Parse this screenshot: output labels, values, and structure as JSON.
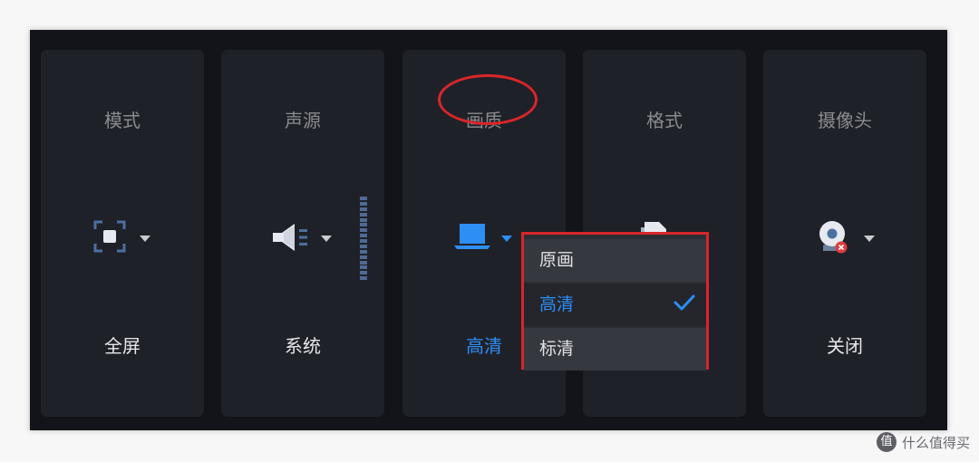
{
  "cards": [
    {
      "title": "模式",
      "value": "全屏",
      "icon": "fullscreen-icon"
    },
    {
      "title": "声源",
      "value": "系统",
      "icon": "speaker-icon"
    },
    {
      "title": "画质",
      "value": "高清",
      "icon": "laptop-icon"
    },
    {
      "title": "格式",
      "value": "",
      "icon": "file-icon"
    },
    {
      "title": "摄像头",
      "value": "关闭",
      "icon": "camera-off-icon"
    }
  ],
  "quality_dropdown": {
    "options": [
      "原画",
      "高清",
      "标清"
    ],
    "selected": "高清"
  },
  "volume_level": 1.0,
  "colors": {
    "accent": "#2d8ef4",
    "highlight": "#d8262a",
    "panel": "#131419",
    "card": "#1f2128"
  },
  "watermark": {
    "logo_text": "值",
    "text": "什么值得买"
  }
}
